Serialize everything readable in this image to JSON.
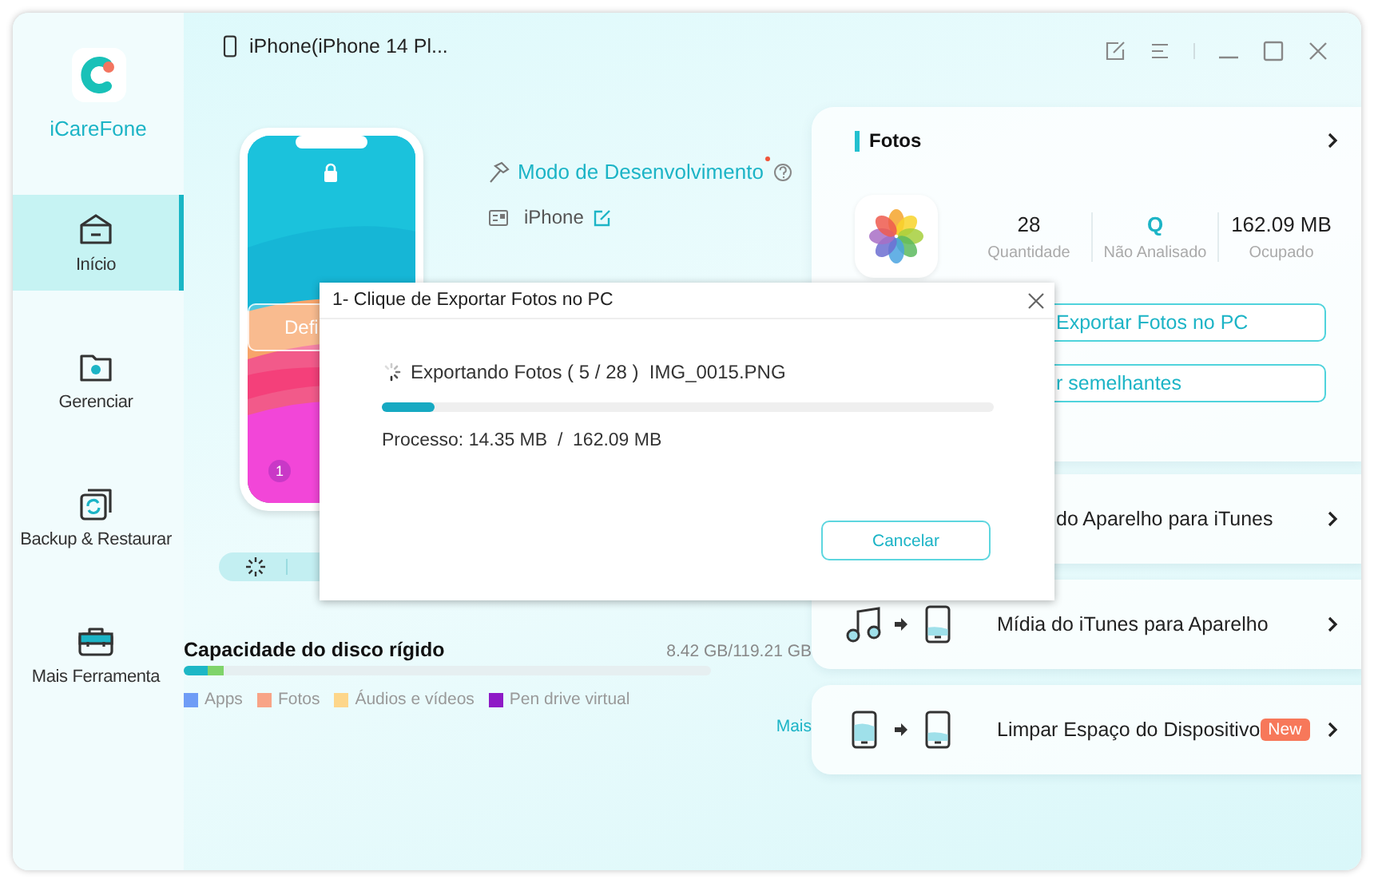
{
  "app": {
    "name": "iCareFone"
  },
  "sidebar": {
    "items": [
      {
        "label": "Início",
        "selected": true
      },
      {
        "label": "Gerenciar",
        "selected": false
      },
      {
        "label": "Backup & Restaurar",
        "selected": false
      },
      {
        "label": "Mais Ferramenta",
        "selected": false
      }
    ]
  },
  "device": {
    "title": "iPhone(iPhone 14 Pl...",
    "mode": "Modo de Desenvolvimento",
    "name": "iPhone"
  },
  "phone_preview": {
    "button": "Defi",
    "badge": "1"
  },
  "storage": {
    "title": "Capacidade do disco rígido",
    "usage": "8.42 GB/119.21 GB",
    "segments": [
      {
        "color": "#1db7c6",
        "level": 0.045
      },
      {
        "color": "#7fd46a",
        "level": 0.03
      }
    ],
    "legend": [
      {
        "label": "Apps",
        "color": "#6f9cf6"
      },
      {
        "label": "Fotos",
        "color": "#f8a487"
      },
      {
        "label": "Áudios e vídeos",
        "color": "#fdd68a"
      },
      {
        "label": "Pen drive virtual",
        "color": "#8e1ac6"
      }
    ],
    "more_link": "Mais"
  },
  "photos_card": {
    "title": "Fotos",
    "stats": [
      {
        "value": "28",
        "label": "Quantidade",
        "accent": false
      },
      {
        "value": "Q",
        "label": "Não Analisado",
        "accent": true
      },
      {
        "value": "162.09 MB",
        "label": "Ocupado",
        "accent": false
      }
    ],
    "buttons": [
      "Exportar Fotos no PC",
      "r semelhantes"
    ]
  },
  "tools": [
    {
      "label": "do Aparelho para iTunes",
      "kind": "covered"
    },
    {
      "label": "Mídia do iTunes para Aparelho",
      "kind": "music"
    },
    {
      "label": "Limpar Espaço do Dispositivo",
      "kind": "clean",
      "badge": "New"
    }
  ],
  "dialog": {
    "title": "1- Clique de Exportar Fotos no PC",
    "status": "Exportando Fotos ( 5 / 28 )  IMG_0015.PNG",
    "level": 0.087,
    "progress": "Processo: 14.35 MB  /  162.09 MB",
    "button": "Cancelar"
  }
}
